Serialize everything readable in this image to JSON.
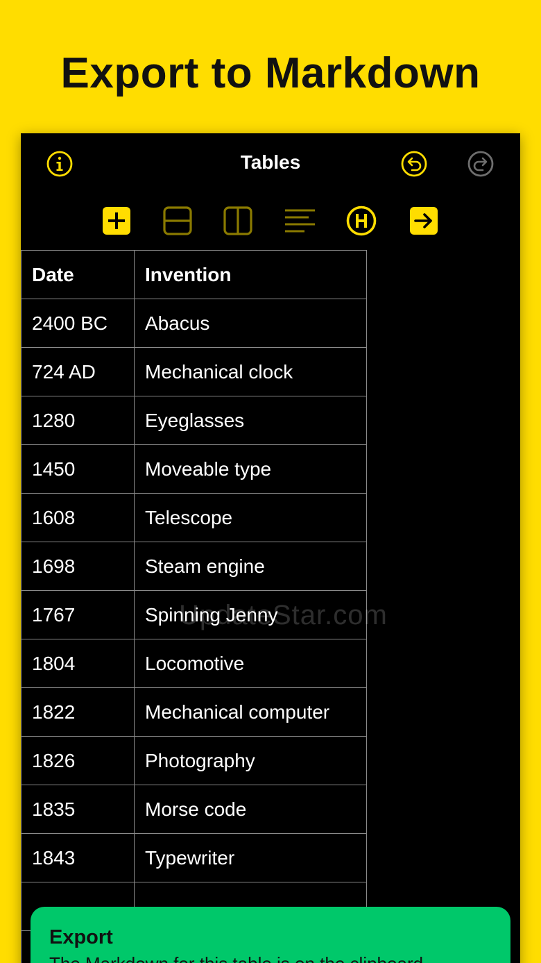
{
  "headline": "Export to Markdown",
  "app": {
    "title": "Tables",
    "accent_color": "#FFDD00",
    "background_color": "#000000",
    "nav_icons": [
      "info-icon",
      "undo-icon",
      "redo-icon"
    ],
    "toolbar_icons": [
      "add-icon",
      "insert-row-icon",
      "insert-column-icon",
      "align-icon",
      "header-icon",
      "export-icon"
    ]
  },
  "table": {
    "headers": [
      "Date",
      "Invention"
    ],
    "rows": [
      [
        "2400 BC",
        "Abacus"
      ],
      [
        "724 AD",
        "Mechanical clock"
      ],
      [
        "1280",
        "Eyeglasses"
      ],
      [
        "1450",
        "Moveable type"
      ],
      [
        "1608",
        "Telescope"
      ],
      [
        "1698",
        "Steam engine"
      ],
      [
        "1767",
        "Spinning Jenny"
      ],
      [
        "1804",
        "Locomotive"
      ],
      [
        "1822",
        "Mechanical computer"
      ],
      [
        "1826",
        "Photography"
      ],
      [
        "1835",
        "Morse code"
      ],
      [
        "1843",
        "Typewriter"
      ],
      [
        "",
        ""
      ],
      [
        "",
        ""
      ]
    ]
  },
  "watermark": "UpdateStar.com",
  "toast": {
    "title": "Export",
    "message": "The Markdown for this table is on the clipboard.",
    "color": "#00C86A"
  }
}
